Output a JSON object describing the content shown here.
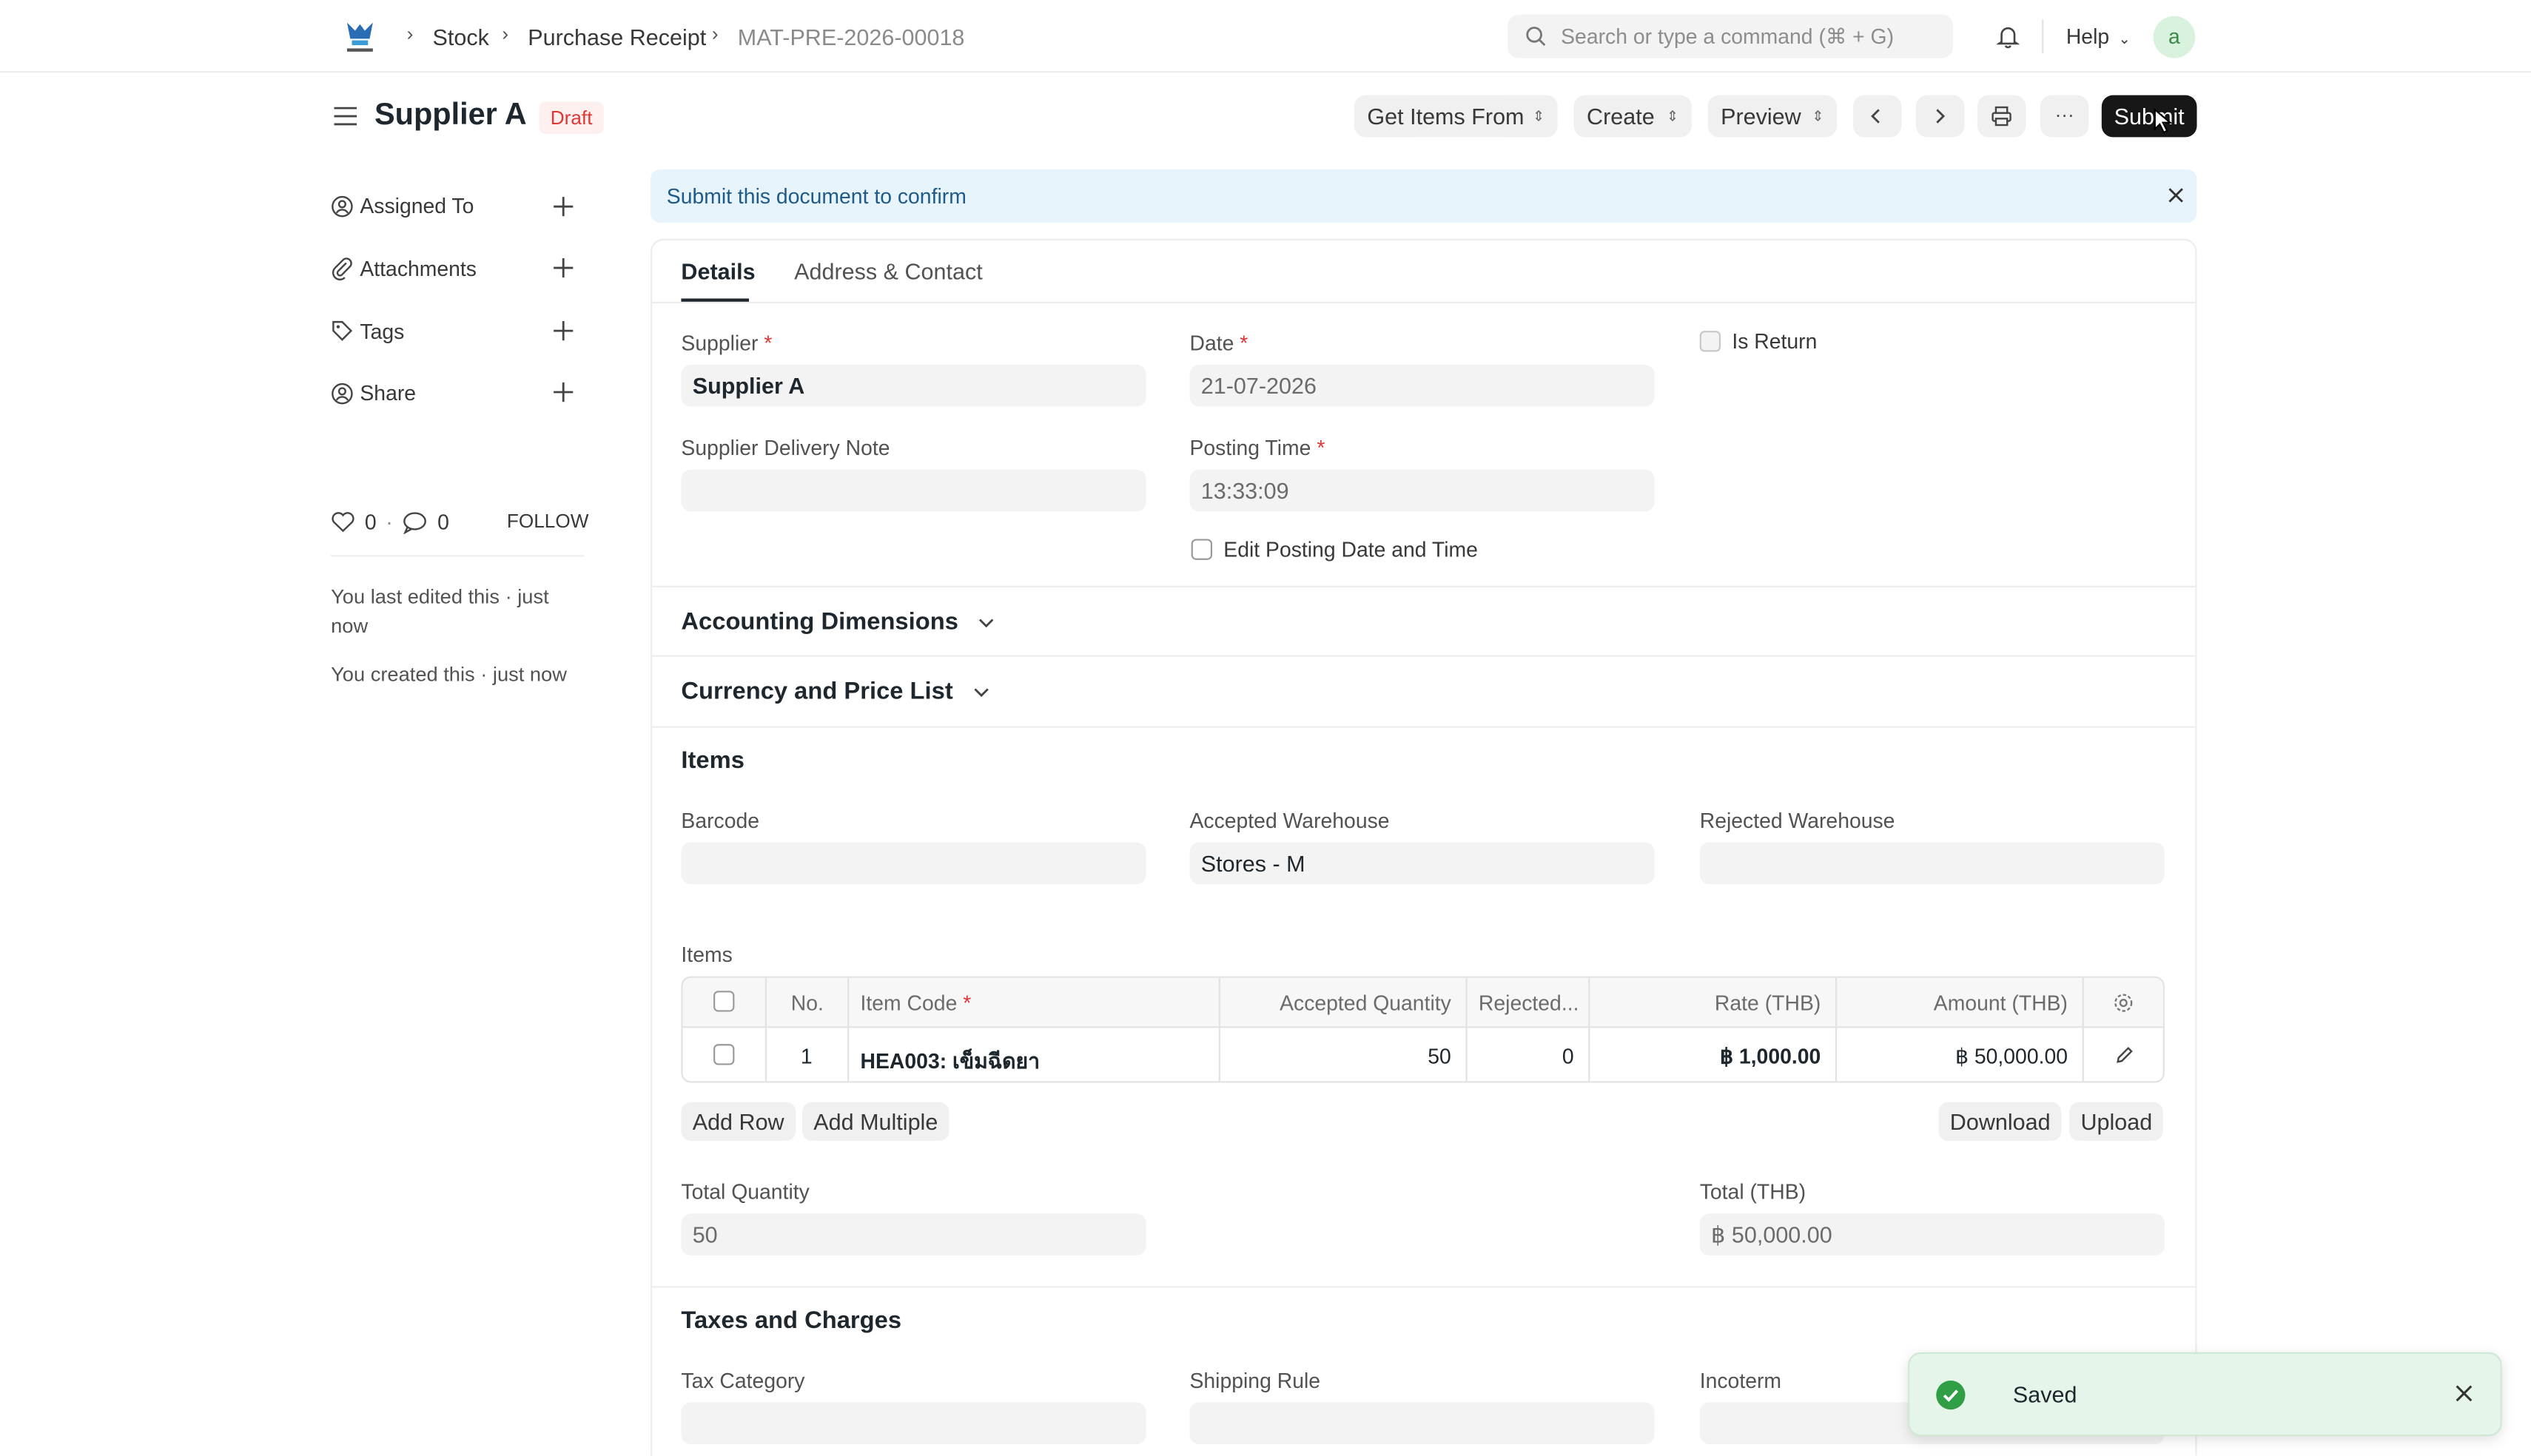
{
  "navbar": {
    "breadcrumbs": [
      "Stock",
      "Purchase Receipt",
      "MAT-PRE-2026-00018"
    ],
    "search_placeholder": "Search or type a command (⌘ + G)",
    "help_label": "Help",
    "avatar_letter": "a"
  },
  "header": {
    "title": "Supplier A",
    "status": "Draft",
    "buttons": {
      "get_items_from": "Get Items From",
      "create": "Create",
      "preview": "Preview",
      "submit": "Submit"
    }
  },
  "sidebar": {
    "items": [
      {
        "label": "Assigned To",
        "icon": "user-add-icon"
      },
      {
        "label": "Attachments",
        "icon": "paperclip-icon"
      },
      {
        "label": "Tags",
        "icon": "tag-icon"
      },
      {
        "label": "Share",
        "icon": "share-icon"
      }
    ],
    "likes": "0",
    "comments": "0",
    "follow_label": "FOLLOW",
    "activity": [
      "You last edited this · just now",
      "You created this · just now"
    ]
  },
  "alert": {
    "message": "Submit this document to confirm"
  },
  "tabs": [
    "Details",
    "Address & Contact"
  ],
  "details": {
    "supplier_label": "Supplier",
    "supplier_value": "Supplier A",
    "date_label": "Date",
    "date_value": "21-07-2026",
    "is_return_label": "Is Return",
    "supplier_delivery_note_label": "Supplier Delivery Note",
    "supplier_delivery_note_value": "",
    "posting_time_label": "Posting Time",
    "posting_time_value": "13:33:09",
    "edit_posting_label": "Edit Posting Date and Time"
  },
  "sections": {
    "accounting_dimensions": "Accounting Dimensions",
    "currency_price_list": "Currency and Price List",
    "items": "Items",
    "taxes_charges": "Taxes and Charges"
  },
  "items_section": {
    "barcode_label": "Barcode",
    "barcode_value": "",
    "accepted_warehouse_label": "Accepted Warehouse",
    "accepted_warehouse_value": "Stores - M",
    "rejected_warehouse_label": "Rejected Warehouse",
    "rejected_warehouse_value": "",
    "table_label": "Items",
    "columns": [
      "No.",
      "Item Code",
      "Accepted Quantity",
      "Rejected...",
      "Rate (THB)",
      "Amount (THB)"
    ],
    "rows": [
      {
        "no": "1",
        "item_code": "HEA003: เข็มฉีดยา",
        "accepted_qty": "50",
        "rejected_qty": "0",
        "rate": "฿ 1,000.00",
        "amount": "฿ 50,000.00"
      }
    ],
    "add_row": "Add Row",
    "add_multiple": "Add Multiple",
    "download": "Download",
    "upload": "Upload",
    "total_quantity_label": "Total Quantity",
    "total_quantity_value": "50",
    "total_label": "Total (THB)",
    "total_value": "฿ 50,000.00"
  },
  "taxes": {
    "tax_category_label": "Tax Category",
    "shipping_rule_label": "Shipping Rule",
    "incoterm_label": "Incoterm"
  },
  "toast": {
    "message": "Saved"
  },
  "colors": {
    "accent_dark": "#171717",
    "draft_badge": "#e03636",
    "toast_bg": "#e5f5e9",
    "toast_check": "#2f9e44"
  }
}
